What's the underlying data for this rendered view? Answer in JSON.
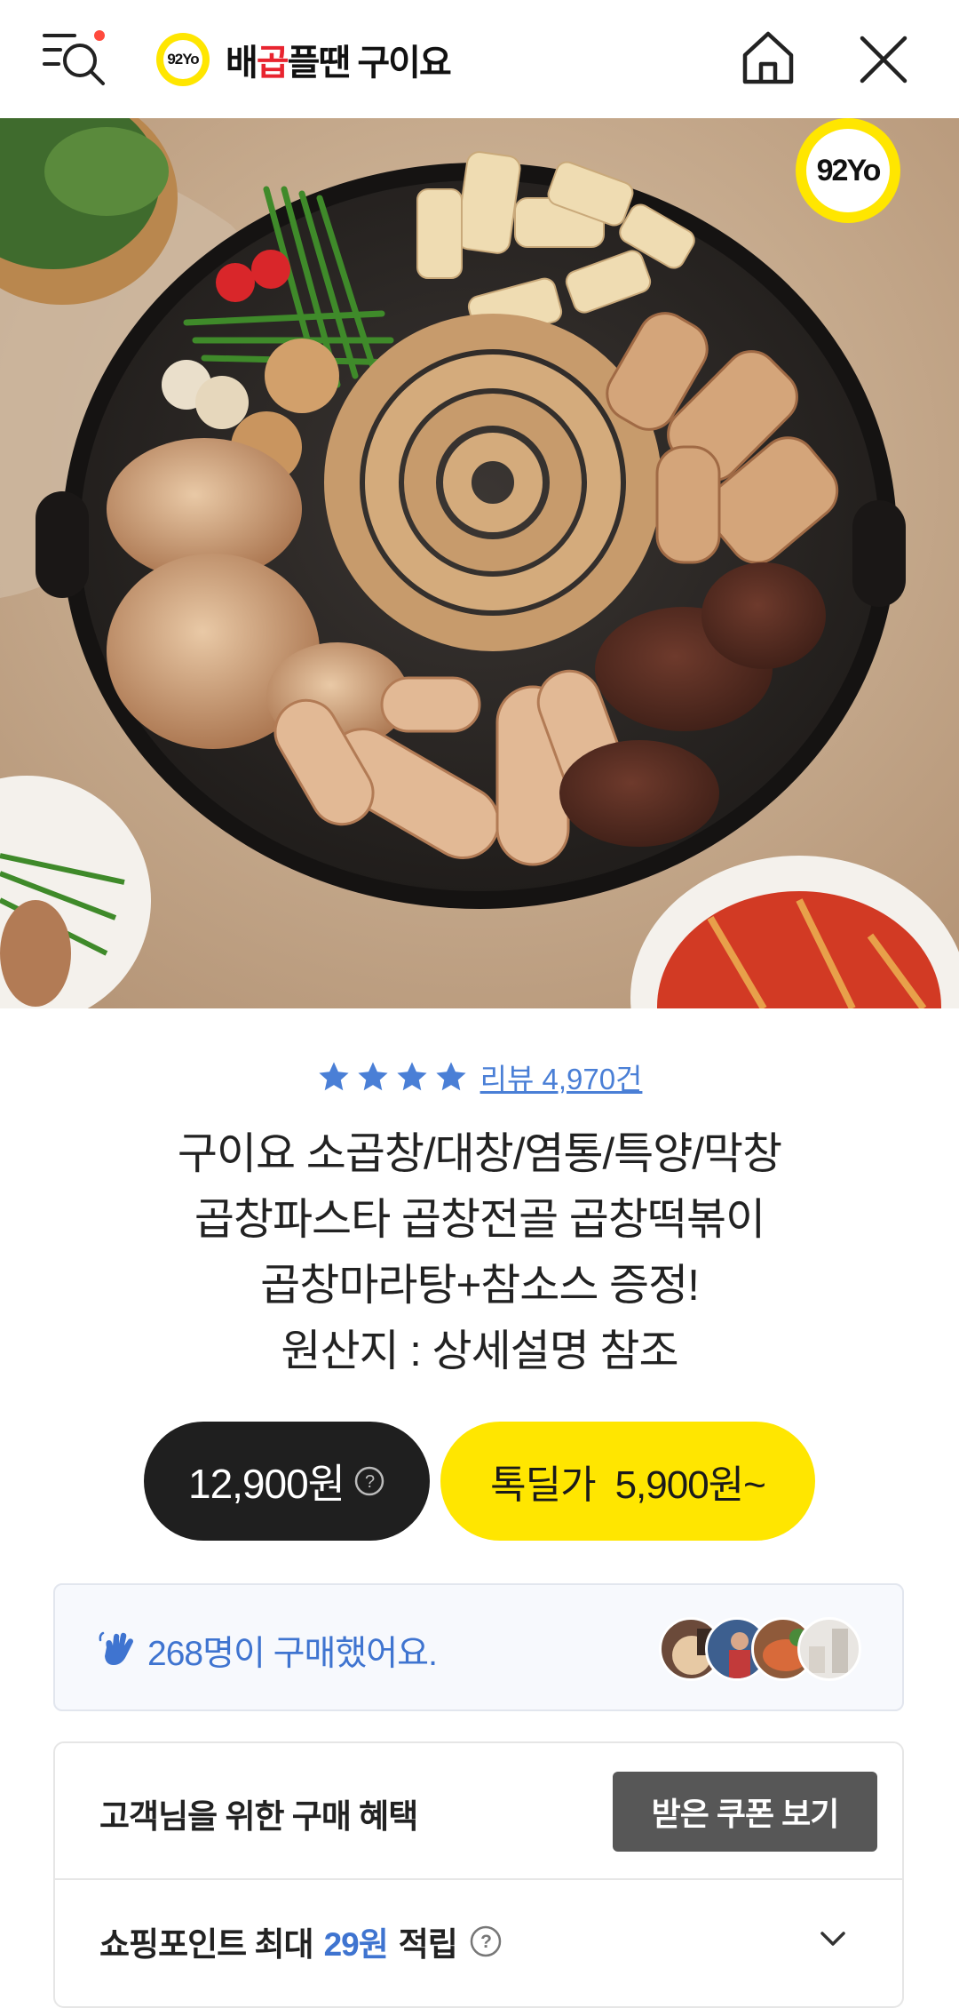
{
  "header": {
    "logo_badge": "92Yo",
    "logo_text_part1": "배",
    "logo_text_accent": "곱",
    "logo_text_part2": "플땐 구이요"
  },
  "hero": {
    "badge_text": "92Yo"
  },
  "rating": {
    "stars": 4,
    "review_text": "리뷰 4,970건"
  },
  "product": {
    "title_lines": [
      "구이요 소곱창/대창/염통/특양/막창",
      "곱창파스타 곱창전골 곱창떡볶이",
      "곱창마라탕+참소스 증정!",
      "원산지 : 상세설명 참조"
    ]
  },
  "price": {
    "regular": "12,900원",
    "deal_label": "톡딜가",
    "deal_price": "5,900원~"
  },
  "purchase_info": {
    "text": "268명이 구매했어요."
  },
  "benefit": {
    "title": "고객님을 위한 구매 혜택",
    "coupon_button": "받은 쿠폰 보기",
    "points_prefix": "쇼핑포인트 최대",
    "points_value": "29원",
    "points_suffix": "적립"
  },
  "colors": {
    "accent_yellow": "#ffe600",
    "link_blue": "#4a7fd6",
    "dark_button": "#1f1f1f",
    "coupon_button": "#575757"
  }
}
